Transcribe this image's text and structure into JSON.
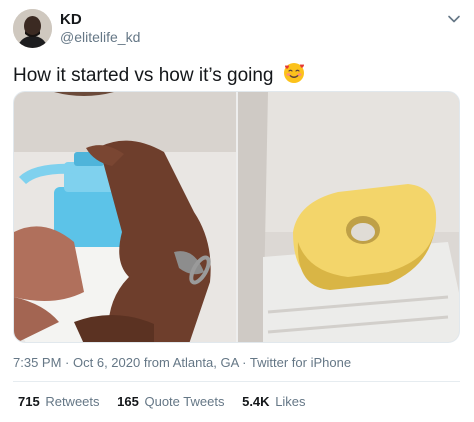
{
  "author": {
    "name": "KD",
    "handle": "@elitelife_kd"
  },
  "tweet": {
    "text": "How it started vs how it’s going",
    "emoji": "smiling-face-with-hearts-emoji"
  },
  "meta": {
    "time": "7:35 PM",
    "date": "Oct 6, 2020",
    "location_prefix": "from",
    "location": "Atlanta, GA",
    "separator": "·",
    "source": "Twitter for iPhone"
  },
  "stats": {
    "retweets_count": "715",
    "retweets_label": "Retweets",
    "quotes_count": "165",
    "quotes_label": "Quote Tweets",
    "likes_count": "5.4K",
    "likes_label": "Likes"
  },
  "colors": {
    "text": "#14171a",
    "secondary": "#657786",
    "divider": "#e6ecf0",
    "bottle_blue": "#5cc3e8",
    "soap_yellow": "#f3d56a"
  }
}
